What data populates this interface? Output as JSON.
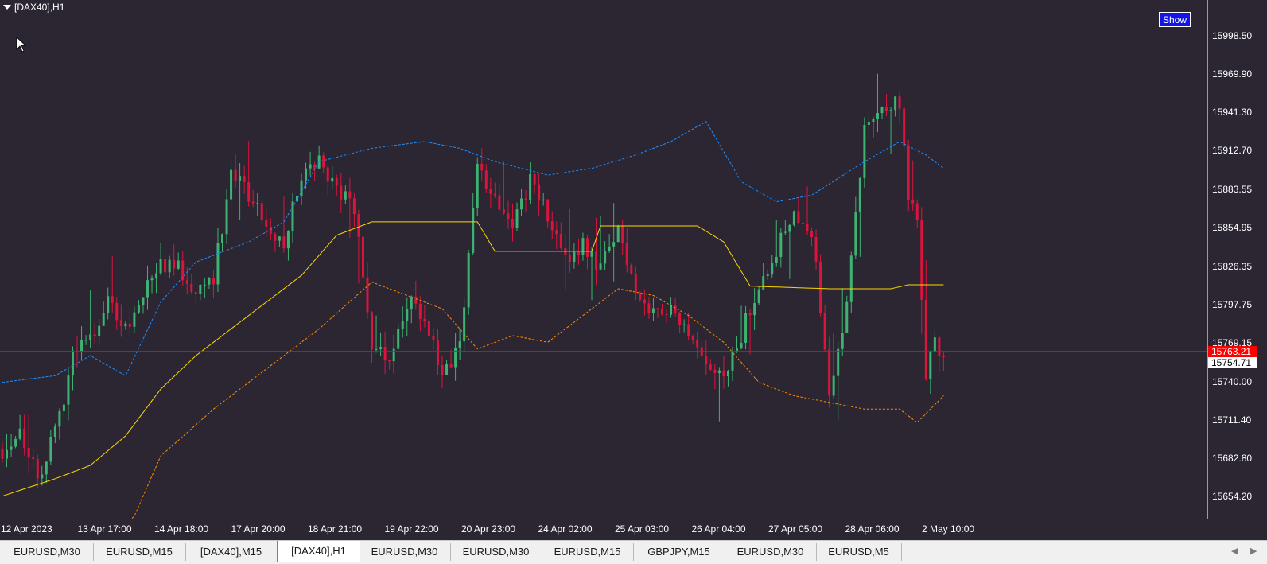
{
  "window": {
    "title": "[DAX40],H1",
    "show_button": "Show"
  },
  "colors": {
    "background": "#2b2632",
    "bull": "#3cb371",
    "bear": "#dc143c",
    "upper_band": "#1e90ff",
    "lower_band": "#ff8c00",
    "middle_line": "#ffd700",
    "price_line": "#ff0000"
  },
  "price_axis": {
    "ticks": [
      "15998.50",
      "15969.90",
      "15941.30",
      "15912.70",
      "15883.55",
      "15854.95",
      "15826.35",
      "15797.75",
      "15769.15",
      "15740.00",
      "15711.40",
      "15682.80",
      "15654.20"
    ],
    "current_price": "15763.21",
    "bid_price": "15754.71"
  },
  "time_axis": {
    "ticks": [
      "12 Apr 2023",
      "13 Apr 17:00",
      "14 Apr 18:00",
      "17 Apr 20:00",
      "18 Apr 21:00",
      "19 Apr 22:00",
      "20 Apr 23:00",
      "24 Apr 02:00",
      "25 Apr 03:00",
      "26 Apr 04:00",
      "27 Apr 05:00",
      "28 Apr 06:00",
      "2 May 10:00"
    ]
  },
  "chart_data": {
    "type": "candlestick",
    "symbol": "[DAX40]",
    "timeframe": "H1",
    "ylim": [
      15640,
      16010
    ],
    "current_price": 15763.21,
    "bid": 15754.71,
    "close_path": [
      [
        0,
        15690
      ],
      [
        4,
        15705
      ],
      [
        8,
        15670
      ],
      [
        12,
        15700
      ],
      [
        16,
        15760
      ],
      [
        20,
        15775
      ],
      [
        24,
        15800
      ],
      [
        28,
        15780
      ],
      [
        32,
        15805
      ],
      [
        36,
        15830
      ],
      [
        40,
        15825
      ],
      [
        44,
        15810
      ],
      [
        48,
        15820
      ],
      [
        52,
        15895
      ],
      [
        56,
        15880
      ],
      [
        60,
        15860
      ],
      [
        64,
        15845
      ],
      [
        68,
        15895
      ],
      [
        72,
        15905
      ],
      [
        76,
        15885
      ],
      [
        80,
        15870
      ],
      [
        84,
        15770
      ],
      [
        88,
        15760
      ],
      [
        92,
        15800
      ],
      [
        96,
        15790
      ],
      [
        100,
        15740
      ],
      [
        104,
        15770
      ],
      [
        108,
        15900
      ],
      [
        112,
        15880
      ],
      [
        116,
        15860
      ],
      [
        120,
        15890
      ],
      [
        124,
        15865
      ],
      [
        128,
        15830
      ],
      [
        132,
        15845
      ],
      [
        136,
        15825
      ],
      [
        140,
        15855
      ],
      [
        144,
        15810
      ],
      [
        148,
        15790
      ],
      [
        152,
        15800
      ],
      [
        156,
        15770
      ],
      [
        160,
        15750
      ],
      [
        164,
        15740
      ],
      [
        168,
        15775
      ],
      [
        172,
        15815
      ],
      [
        176,
        15840
      ],
      [
        180,
        15870
      ],
      [
        184,
        15855
      ],
      [
        188,
        15730
      ],
      [
        192,
        15800
      ],
      [
        196,
        15930
      ],
      [
        200,
        15945
      ],
      [
        204,
        15950
      ],
      [
        206,
        15875
      ],
      [
        208,
        15860
      ],
      [
        210,
        15745
      ],
      [
        212,
        15770
      ],
      [
        214,
        15757
      ]
    ],
    "bollinger": {
      "upper": [
        [
          0,
          15740
        ],
        [
          12,
          15745
        ],
        [
          20,
          15760
        ],
        [
          28,
          15745
        ],
        [
          36,
          15800
        ],
        [
          44,
          15830
        ],
        [
          56,
          15845
        ],
        [
          64,
          15860
        ],
        [
          72,
          15905
        ],
        [
          84,
          15915
        ],
        [
          96,
          15920
        ],
        [
          104,
          15915
        ],
        [
          112,
          15905
        ],
        [
          124,
          15895
        ],
        [
          134,
          15900
        ],
        [
          144,
          15910
        ],
        [
          152,
          15920
        ],
        [
          160,
          15935
        ],
        [
          168,
          15890
        ],
        [
          176,
          15875
        ],
        [
          184,
          15880
        ],
        [
          196,
          15905
        ],
        [
          204,
          15920
        ],
        [
          210,
          15910
        ],
        [
          214,
          15900
        ]
      ],
      "middle": [
        [
          0,
          15655
        ],
        [
          12,
          15668
        ],
        [
          20,
          15678
        ],
        [
          28,
          15700
        ],
        [
          36,
          15735
        ],
        [
          44,
          15760
        ],
        [
          56,
          15790
        ],
        [
          68,
          15820
        ],
        [
          76,
          15850
        ],
        [
          84,
          15860
        ],
        [
          108,
          15860
        ],
        [
          112,
          15838
        ],
        [
          134,
          15838
        ],
        [
          136,
          15857
        ],
        [
          158,
          15857
        ],
        [
          164,
          15845
        ],
        [
          170,
          15812
        ],
        [
          188,
          15810
        ],
        [
          202,
          15810
        ],
        [
          206,
          15813
        ],
        [
          214,
          15813
        ]
      ],
      "lower": [
        [
          0,
          15600
        ],
        [
          12,
          15590
        ],
        [
          20,
          15610
        ],
        [
          30,
          15640
        ],
        [
          36,
          15685
        ],
        [
          48,
          15720
        ],
        [
          60,
          15750
        ],
        [
          72,
          15780
        ],
        [
          84,
          15815
        ],
        [
          92,
          15805
        ],
        [
          100,
          15795
        ],
        [
          108,
          15765
        ],
        [
          116,
          15775
        ],
        [
          124,
          15770
        ],
        [
          134,
          15795
        ],
        [
          140,
          15810
        ],
        [
          148,
          15805
        ],
        [
          156,
          15790
        ],
        [
          164,
          15770
        ],
        [
          172,
          15740
        ],
        [
          180,
          15730
        ],
        [
          188,
          15725
        ],
        [
          196,
          15720
        ],
        [
          204,
          15720
        ],
        [
          208,
          15710
        ],
        [
          214,
          15730
        ]
      ]
    }
  },
  "tabs": [
    {
      "label": "EURUSD,M30",
      "active": false
    },
    {
      "label": "EURUSD,M15",
      "active": false
    },
    {
      "label": "[DAX40],M15",
      "active": false
    },
    {
      "label": "[DAX40],H1",
      "active": true
    },
    {
      "label": "EURUSD,M30",
      "active": false
    },
    {
      "label": "EURUSD,M30",
      "active": false
    },
    {
      "label": "EURUSD,M15",
      "active": false
    },
    {
      "label": "GBPJPY,M15",
      "active": false
    },
    {
      "label": "EURUSD,M30",
      "active": false
    },
    {
      "label": "EURUSD,M5",
      "active": false
    }
  ],
  "tab_nav": {
    "prev": "◀",
    "next": "▶"
  }
}
